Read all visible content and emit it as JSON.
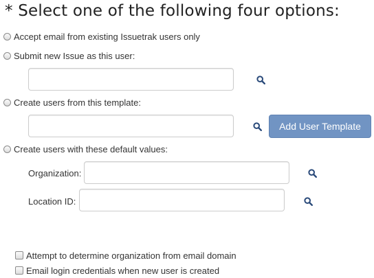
{
  "heading": "* Select one of the following four options:",
  "options": [
    {
      "label": "Accept email from existing Issuetrak users only",
      "selected": false
    },
    {
      "label": "Submit new Issue as this user:",
      "selected": false
    },
    {
      "label": "Create users from this template:",
      "selected": false
    },
    {
      "label": "Create users with these default values:",
      "selected": false
    }
  ],
  "submit_user": {
    "value": ""
  },
  "template": {
    "value": "",
    "button_label": "Add User Template"
  },
  "defaults": {
    "organization_label": "Organization:",
    "organization_value": "",
    "location_label": "Location ID:",
    "location_value": ""
  },
  "checkboxes": [
    {
      "label": "Attempt to determine organization from email domain",
      "checked": false
    },
    {
      "label": "Email login credentials when new user is created",
      "checked": false
    }
  ],
  "colors": {
    "button_bg": "#7194c3",
    "icon": "#2a4a7a"
  },
  "icons": [
    "search-icon"
  ]
}
